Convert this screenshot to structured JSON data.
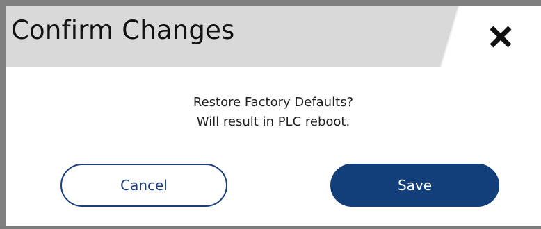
{
  "dialog": {
    "title": "Confirm Changes",
    "close_icon": "close-x-icon",
    "message_line1": "Restore Factory Defaults?",
    "message_line2": "Will result in PLC reboot.",
    "cancel_label": "Cancel",
    "save_label": "Save"
  },
  "colors": {
    "title_band": "#d9d9d9",
    "frame": "#7f7f7f",
    "primary": "#123f7a",
    "cancel_border": "#1c3f7c",
    "text": "#222222"
  }
}
